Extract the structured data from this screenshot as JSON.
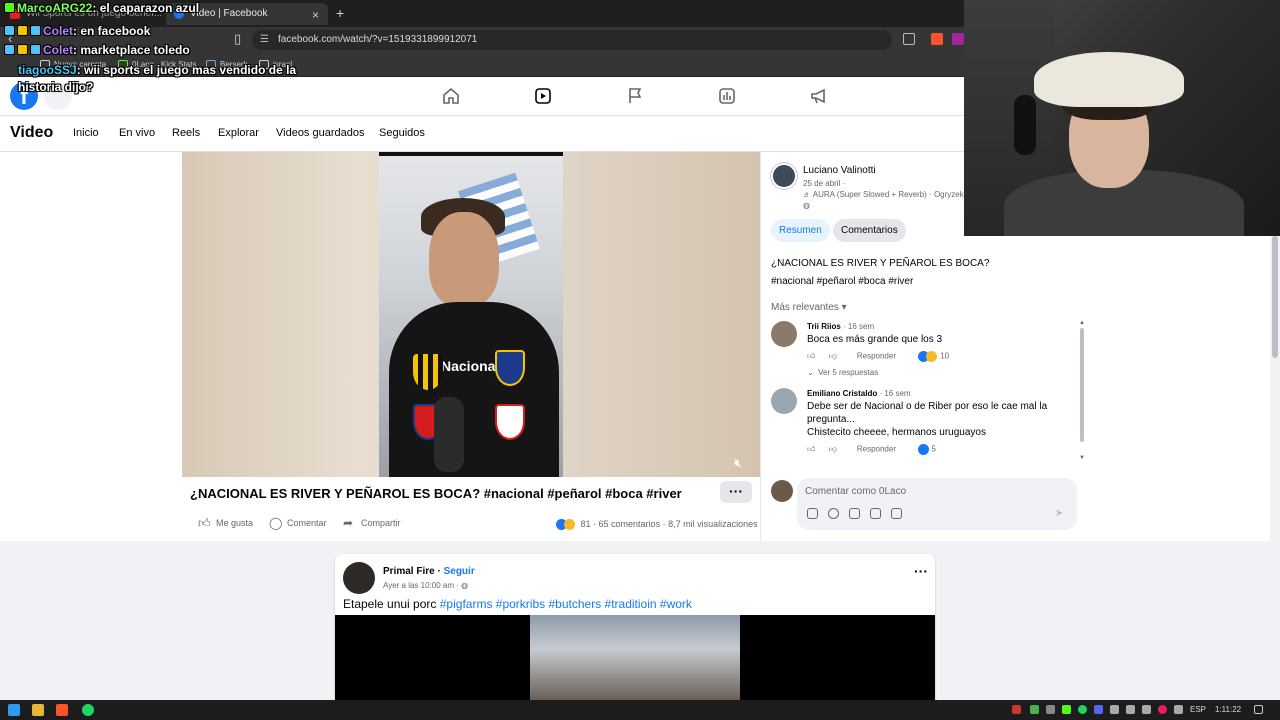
{
  "browser": {
    "tabs": [
      {
        "title": "Wii Sports es un juego benéf...",
        "active": false
      },
      {
        "title": "Video | Facebook",
        "active": true
      }
    ],
    "url": "facebook.com/watch/?v=1519331899912071",
    "bookmarks": [
      "Nueva carpeta",
      "0Laco - Kick Stats",
      "Berserk",
      "israel"
    ]
  },
  "fb_header": {
    "logo": "f",
    "nav_icons": [
      "home-icon",
      "video-icon",
      "flag-icon",
      "marketplace-icon",
      "megaphone-icon"
    ]
  },
  "video_nav": {
    "title": "Video",
    "items": [
      "Inicio",
      "En vivo",
      "Reels",
      "Explorar",
      "Videos guardados",
      "Seguidos"
    ]
  },
  "video_post": {
    "shirt_text": "Nacional",
    "title": "¿NACIONAL ES RIVER Y PEÑAROL ES BOCA? #nacional #peñarol #boca #river",
    "more": "···",
    "actions": [
      "Me gusta",
      "Comentar",
      "Compartir"
    ],
    "reactions_count": "81",
    "comments_count": "65 comentarios",
    "views": "8,7 mil visualizaciones"
  },
  "side_panel": {
    "author": "Luciano Valinotti",
    "date": "25 de abril ·",
    "music": "♬ AURA (Super Slowed + Reverb) · Ogryzek",
    "tabs": [
      "Resumen",
      "Comentarios"
    ],
    "description": "¿NACIONAL ES RIVER Y PEÑAROL ES BOCA?",
    "hashtags": "#nacional #peñarol #boca #river",
    "sort_label": "Más relevantes",
    "comments": [
      {
        "author": "Trii Riios",
        "time": "· 16 sem",
        "text": "Boca es más grande que los 3",
        "reply": "Responder",
        "reactions": "10",
        "replies": "Ver 5 respuestas"
      },
      {
        "author": "Emiliano Cristaldo",
        "time": "· 16 sem",
        "text": "Debe ser de Nacional o de Riber por eso le cae mal la pregunta...",
        "text2": "Chistecito cheeee, hermanos uruguayos",
        "reply": "Responder",
        "reactions": "5"
      }
    ],
    "composer_placeholder": "Comentar como 0Laco"
  },
  "feed_post": {
    "author": "Primal Fire",
    "follow": "Seguir",
    "time": "Ayer a las 10:00 am ·",
    "text": "Etapele unui porc",
    "hashtags": [
      "#pigfarms",
      "#porkribs",
      "#butchers",
      "#traditioin",
      "#work"
    ]
  },
  "chat": [
    {
      "user": "MarcoARG22",
      "message": "el caparazon azul"
    },
    {
      "user": "Colet",
      "message": "en facebook"
    },
    {
      "user": "Colet",
      "message": "marketplace toledo"
    },
    {
      "user": "tiagooSSJ",
      "message": "wii sports el juego mas vendido de la"
    },
    {
      "user": "",
      "message": "historia dijo?"
    }
  ],
  "taskbar": {
    "language": "ESP",
    "time": "1:11:22"
  },
  "colors": {
    "fb_blue": "#1877f2",
    "chrome_dark": "#353535",
    "page_bg": "#f0f2f5"
  }
}
